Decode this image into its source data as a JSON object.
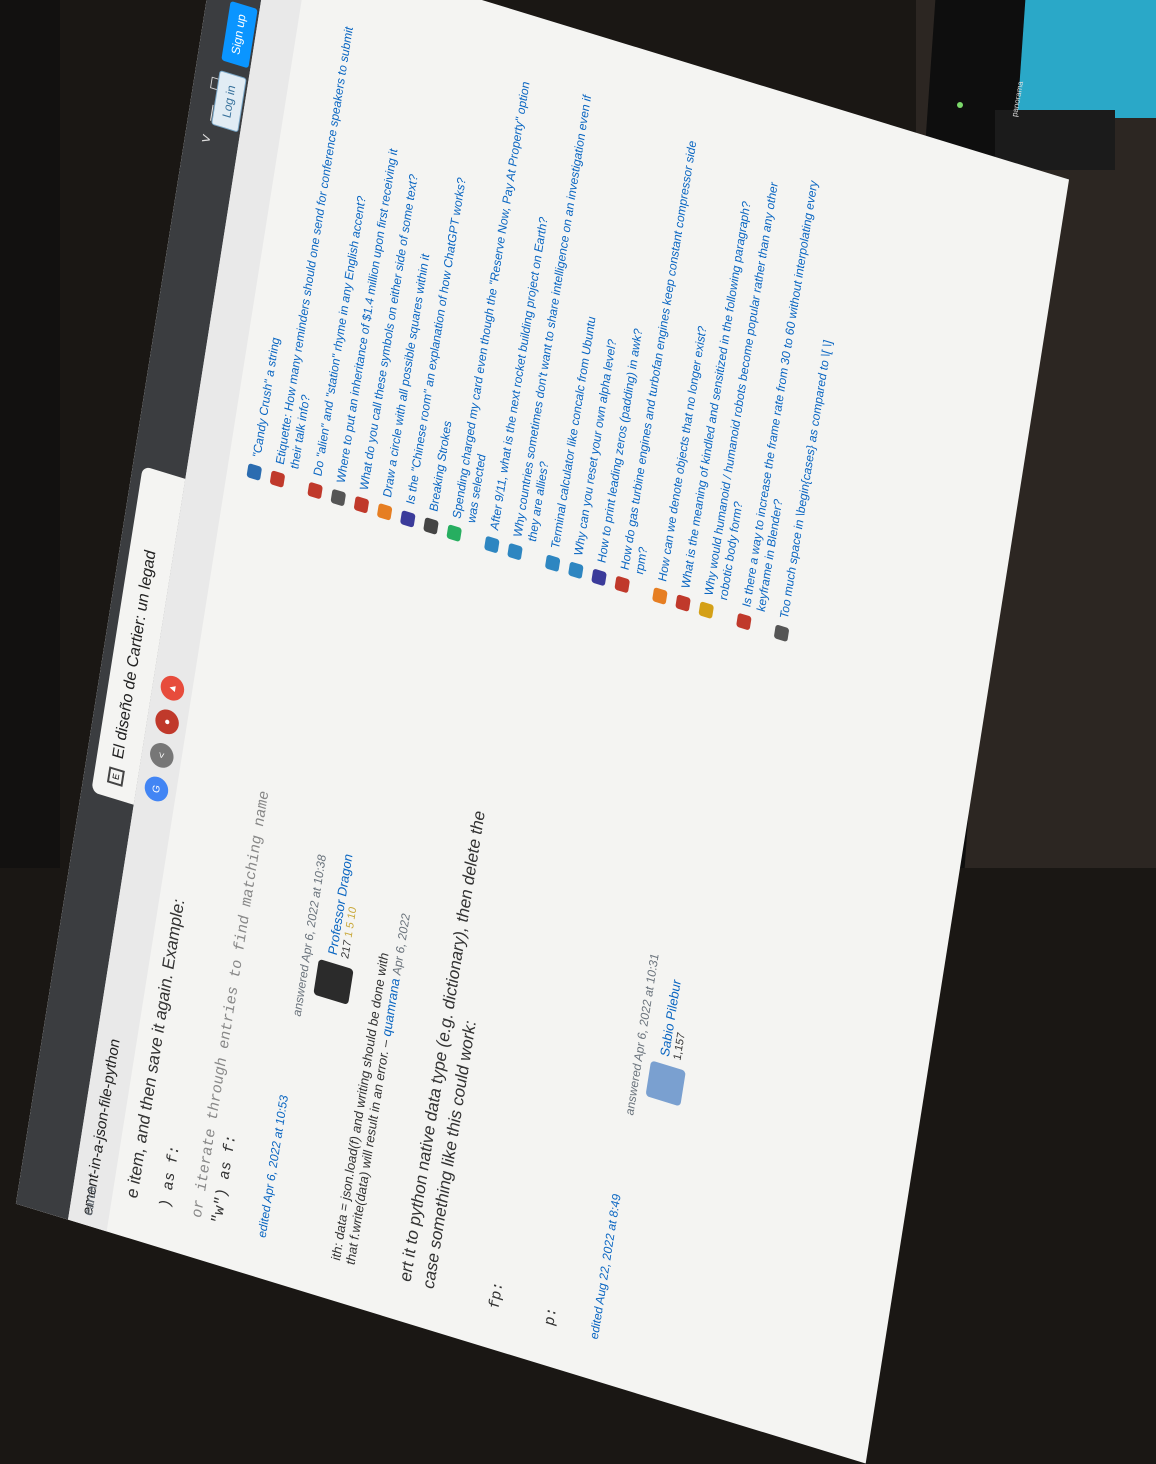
{
  "browser": {
    "tab_title": "El diseño de Cartier: un legad",
    "tab_favicon": "E",
    "new_tab": "+",
    "url_fragment": "ement-in-a-json-file-python",
    "search_label": "earch",
    "window_controls": [
      "˅",
      "—",
      "☐"
    ]
  },
  "auth": {
    "login": "Log in",
    "signup": "Sign up"
  },
  "question_text": {
    "line1": "e item, and then save it again. Example:",
    "code1": ") as f:",
    "code2": "or iterate through entries to find matching name",
    "code3": "\"w\") as f:"
  },
  "answer1": {
    "edited": "edited Apr 6, 2022 at 10:53",
    "answered": "answered Apr 6, 2022 at 10:38",
    "user": "Professor Dragon",
    "rep": "217",
    "badges": "1  5  10"
  },
  "comment": {
    "text_a": "ith: data = json.load(f) and writing should be done with",
    "text_b": "that f.write(data) will result in an error. –",
    "commenter": "quamrana",
    "comment_date": "Apr 6, 2022"
  },
  "answer2_text": {
    "line1": "ert it to python native data type (e.g. dictionary), then delete the",
    "line2": "case something like this could work:",
    "code_a": "fp:",
    "code_b": "p:"
  },
  "answer2": {
    "edited": "edited Aug 22, 2022 at 8:49",
    "answered": "answered Apr 6, 2022 at 10:31",
    "user": "Sabio Pilebur",
    "rep": "1,157"
  },
  "hot_network_questions": [
    {
      "text": "\"Candy Crush\" a string",
      "color": "#2b6cb0"
    },
    {
      "text": "Etiquette: How many reminders should one send for conference speakers to submit their talk info?",
      "color": "#c0392b"
    },
    {
      "text": "Do \"alien\" and \"station\" rhyme in any English accent?",
      "color": "#c0392b"
    },
    {
      "text": "Where to put an inheritance of $1.4 million upon first receiving it",
      "color": "#555555"
    },
    {
      "text": "What do you call these symbols on either side of some text?",
      "color": "#c0392b"
    },
    {
      "text": "Draw a circle with all possible squares within it",
      "color": "#e67e22"
    },
    {
      "text": "Is the \"Chinese room\" an explanation of how ChatGPT works?",
      "color": "#3b3b9a"
    },
    {
      "text": "Breaking Strokes",
      "color": "#444444"
    },
    {
      "text": "Spending charged my card even though the \"Reserve Now, Pay At Property\" option was selected",
      "color": "#27ae60"
    },
    {
      "text": "After 9/11, what is the next rocket building project on Earth?",
      "color": "#2e86c1"
    },
    {
      "text": "Why countries sometimes don't want to share intelligence on an investigation even if they are allies?",
      "color": "#2e86c1"
    },
    {
      "text": "Terminal calculator like concalc from Ubuntu",
      "color": "#2e86c1"
    },
    {
      "text": "Why can you reset your own alpha level?",
      "color": "#2e86c1"
    },
    {
      "text": "How to print leading zeros (padding) in awk?",
      "color": "#3b3b9a"
    },
    {
      "text": "How do gas turbine engines and turbofan engines keep constant compressor side rpm?",
      "color": "#c0392b"
    },
    {
      "text": "How can we denote objects that no longer exist?",
      "color": "#e67e22"
    },
    {
      "text": "What is the meaning of kindled and sensitized in the following paragraph?",
      "color": "#c0392b"
    },
    {
      "text": "Why would humanoid / humanoid robots become popular rather than any other robotic body form?",
      "color": "#d4a017"
    },
    {
      "text": "Is there a way to increase the frame rate from 30 to 60 without interpolating every keyframe in Blender?",
      "color": "#c0392b"
    },
    {
      "text": "Too much space in \\begin{cases} as compared to \\[ \\]",
      "color": "#555555"
    }
  ],
  "taskbar": {
    "label": "panorama"
  }
}
